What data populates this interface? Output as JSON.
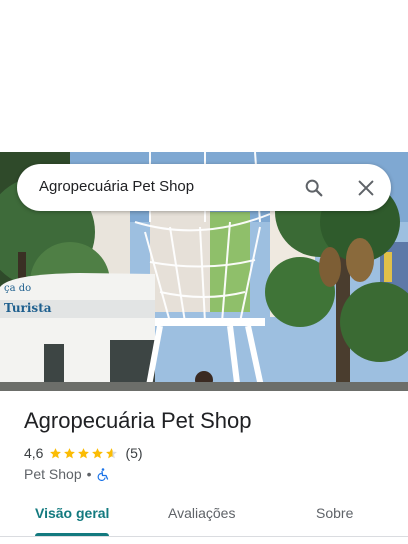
{
  "search": {
    "query": "Agropecuária Pet Shop"
  },
  "place": {
    "name": "Agropecuária Pet Shop",
    "rating": "4,6",
    "rating_value": 4.6,
    "review_count": "(5)",
    "category": "Pet Shop",
    "separator": "•",
    "photo_sign_top": "ça do",
    "photo_sign_bottom": "Turista"
  },
  "tabs": [
    {
      "label": "Visão geral",
      "active": true
    },
    {
      "label": "Avaliações",
      "active": false
    },
    {
      "label": "Sobre",
      "active": false
    }
  ],
  "colors": {
    "accent": "#137a7f",
    "star": "#fbbc04",
    "accessibility_icon": "#1a73e8"
  },
  "icons": {
    "search": "search-icon",
    "close": "close-icon",
    "accessibility": "wheelchair-icon",
    "star": "star-icon"
  }
}
